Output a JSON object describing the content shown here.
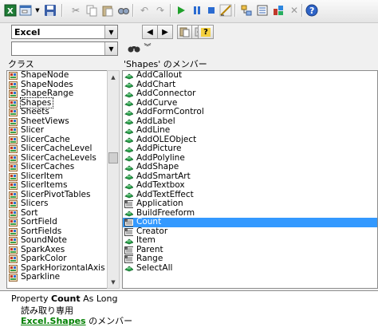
{
  "toolbar": {
    "icons": [
      "excel-icon",
      "userform-icon",
      "save-icon",
      "cut-icon",
      "copy-icon",
      "paste-icon",
      "find-icon",
      "undo-icon",
      "redo-icon",
      "run-icon",
      "break-icon",
      "reset-icon",
      "design-mode-icon",
      "project-explorer-icon",
      "properties-icon",
      "object-browser-icon",
      "toolbox-icon",
      "help-icon"
    ]
  },
  "library_combo": {
    "value": "Excel"
  },
  "search_combo": {
    "value": ""
  },
  "classes_panel": {
    "header": "クラス",
    "items": [
      {
        "label": "ShapeNode"
      },
      {
        "label": "ShapeNodes"
      },
      {
        "label": "ShapeRange"
      },
      {
        "label": "Shapes"
      },
      {
        "label": "Sheets"
      },
      {
        "label": "SheetViews"
      },
      {
        "label": "Slicer"
      },
      {
        "label": "SlicerCache"
      },
      {
        "label": "SlicerCacheLevel"
      },
      {
        "label": "SlicerCacheLevels"
      },
      {
        "label": "SlicerCaches"
      },
      {
        "label": "SlicerItem"
      },
      {
        "label": "SlicerItems"
      },
      {
        "label": "SlicerPivotTables"
      },
      {
        "label": "Slicers"
      },
      {
        "label": "Sort"
      },
      {
        "label": "SortField"
      },
      {
        "label": "SortFields"
      },
      {
        "label": "SoundNote"
      },
      {
        "label": "SparkAxes"
      },
      {
        "label": "SparkColor"
      },
      {
        "label": "SparkHorizontalAxis"
      },
      {
        "label": "Sparkline"
      }
    ],
    "selected": "Shapes"
  },
  "members_panel": {
    "header": "'Shapes' のメンバー",
    "items": [
      {
        "label": "AddCallout",
        "kind": "method"
      },
      {
        "label": "AddChart",
        "kind": "method"
      },
      {
        "label": "AddConnector",
        "kind": "method"
      },
      {
        "label": "AddCurve",
        "kind": "method"
      },
      {
        "label": "AddFormControl",
        "kind": "method"
      },
      {
        "label": "AddLabel",
        "kind": "method"
      },
      {
        "label": "AddLine",
        "kind": "method"
      },
      {
        "label": "AddOLEObject",
        "kind": "method"
      },
      {
        "label": "AddPicture",
        "kind": "method"
      },
      {
        "label": "AddPolyline",
        "kind": "method"
      },
      {
        "label": "AddShape",
        "kind": "method"
      },
      {
        "label": "AddSmartArt",
        "kind": "method"
      },
      {
        "label": "AddTextbox",
        "kind": "method"
      },
      {
        "label": "AddTextEffect",
        "kind": "method"
      },
      {
        "label": "Application",
        "kind": "property"
      },
      {
        "label": "BuildFreeform",
        "kind": "method"
      },
      {
        "label": "Count",
        "kind": "property"
      },
      {
        "label": "Creator",
        "kind": "property"
      },
      {
        "label": "Item",
        "kind": "method"
      },
      {
        "label": "Parent",
        "kind": "property"
      },
      {
        "label": "Range",
        "kind": "property"
      },
      {
        "label": "SelectAll",
        "kind": "method"
      }
    ],
    "selected": "Count"
  },
  "details": {
    "prefix": "Property ",
    "name": "Count",
    "suffix": " As Long",
    "access": "読み取り専用",
    "member_of_link": "Excel.Shapes",
    "member_of_text": " のメンバー"
  },
  "colors": {
    "selection": "#3399ff",
    "link": "#008000"
  }
}
